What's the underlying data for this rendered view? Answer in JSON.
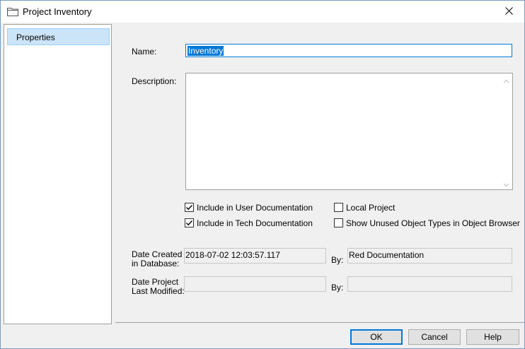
{
  "window": {
    "title": "Project Inventory"
  },
  "sidebar": {
    "items": [
      {
        "label": "Properties"
      }
    ]
  },
  "form": {
    "name_label": "Name:",
    "name_value": "Inventory",
    "description_label": "Description:",
    "description_value": "",
    "checkboxes": [
      {
        "label": "Include in User Documentation",
        "checked": true
      },
      {
        "label": "Include in Tech Documentation",
        "checked": true
      },
      {
        "label": "Local Project",
        "checked": false
      },
      {
        "label": "Show Unused Object Types in Object Browser",
        "checked": false
      }
    ],
    "date_created_label_1": "Date Created",
    "date_created_label_2": "in Database:",
    "date_created_value": "2018-07-02 12:03:57.117",
    "created_by_label": "By:",
    "created_by_value": "Red Documentation",
    "date_modified_label_1": "Date Project",
    "date_modified_label_2": "Last Modified:",
    "date_modified_value": "",
    "modified_by_label": "By:",
    "modified_by_value": ""
  },
  "buttons": {
    "ok": "OK",
    "cancel": "Cancel",
    "help": "Help"
  },
  "icons": {
    "title": "folder-icon",
    "close": "close-icon"
  },
  "colors": {
    "accent": "#0078d7",
    "selection_bg": "#cce4f7"
  }
}
